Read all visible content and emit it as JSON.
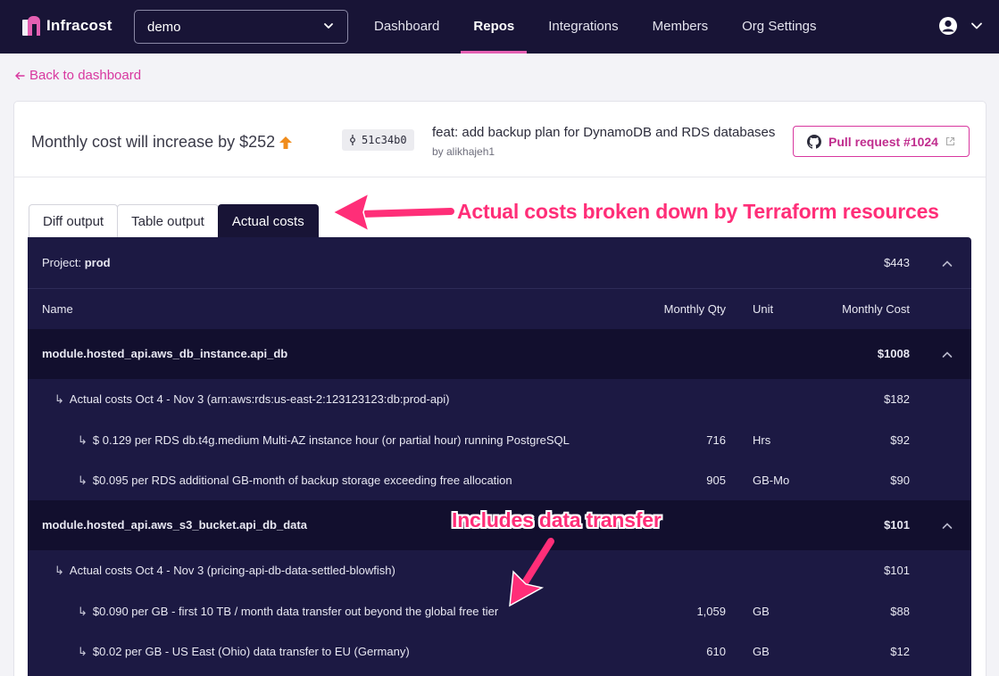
{
  "nav": {
    "brand": "Infracost",
    "org_selected": "demo",
    "links": [
      {
        "label": "Dashboard",
        "active": false
      },
      {
        "label": "Repos",
        "active": true
      },
      {
        "label": "Integrations",
        "active": false
      },
      {
        "label": "Members",
        "active": false
      },
      {
        "label": "Org Settings",
        "active": false
      }
    ],
    "icons": [
      "user-circle-icon",
      "chevron-down-icon"
    ]
  },
  "back_link": "Back to dashboard",
  "header": {
    "cost_summary": "Monthly cost will increase by $252",
    "commit_hash": "51c34b0",
    "commit_message": "feat: add backup plan for DynamoDB and RDS databases",
    "commit_author": "by alikhajeh1",
    "pr_label": "Pull request #1024"
  },
  "tabs": [
    {
      "label": "Diff output",
      "active": false
    },
    {
      "label": "Table output",
      "active": false
    },
    {
      "label": "Actual costs",
      "active": true
    }
  ],
  "annotations": {
    "tabs_note": "Actual costs broken down by Terraform resources",
    "transfer_note": "Includes data transfer"
  },
  "table": {
    "project_label": "Project:",
    "project_name": "prod",
    "project_cost": "$443",
    "columns": {
      "name": "Name",
      "qty": "Monthly Qty",
      "unit": "Unit",
      "cost": "Monthly Cost"
    },
    "rows": [
      {
        "kind": "resource",
        "name": "module.hosted_api.aws_db_instance.api_db",
        "qty": "",
        "unit": "",
        "cost": "$1008"
      },
      {
        "kind": "group",
        "name": "Actual costs Oct 4 - Nov 3 (arn:aws:rds:us-east-2:123123123:db:prod-api)",
        "qty": "",
        "unit": "",
        "cost": "$182"
      },
      {
        "kind": "item",
        "name": "$ 0.129 per RDS db.t4g.medium Multi-AZ instance hour (or partial hour) running PostgreSQL",
        "qty": "716",
        "unit": "Hrs",
        "cost": "$92"
      },
      {
        "kind": "item",
        "name": "$0.095 per RDS additional GB-month of backup storage exceeding free allocation",
        "qty": "905",
        "unit": "GB-Mo",
        "cost": "$90"
      },
      {
        "kind": "resource",
        "name": "module.hosted_api.aws_s3_bucket.api_db_data",
        "qty": "",
        "unit": "",
        "cost": "$101"
      },
      {
        "kind": "group",
        "name": "Actual costs Oct 4 - Nov 3 (pricing-api-db-data-settled-blowfish)",
        "qty": "",
        "unit": "",
        "cost": "$101"
      },
      {
        "kind": "item",
        "name": "$0.090 per GB - first 10 TB / month data transfer out beyond the global free tier",
        "qty": "1,059",
        "unit": "GB",
        "cost": "$88"
      },
      {
        "kind": "item",
        "name": "$0.02 per GB - US East (Ohio) data transfer to EU (Germany)",
        "qty": "610",
        "unit": "GB",
        "cost": "$12"
      }
    ]
  },
  "colors": {
    "nav_bg": "#181436",
    "accent": "#e45fb2",
    "link": "#d8379f",
    "table_bg": "#1c1943",
    "annotation": "#ff2e78"
  }
}
